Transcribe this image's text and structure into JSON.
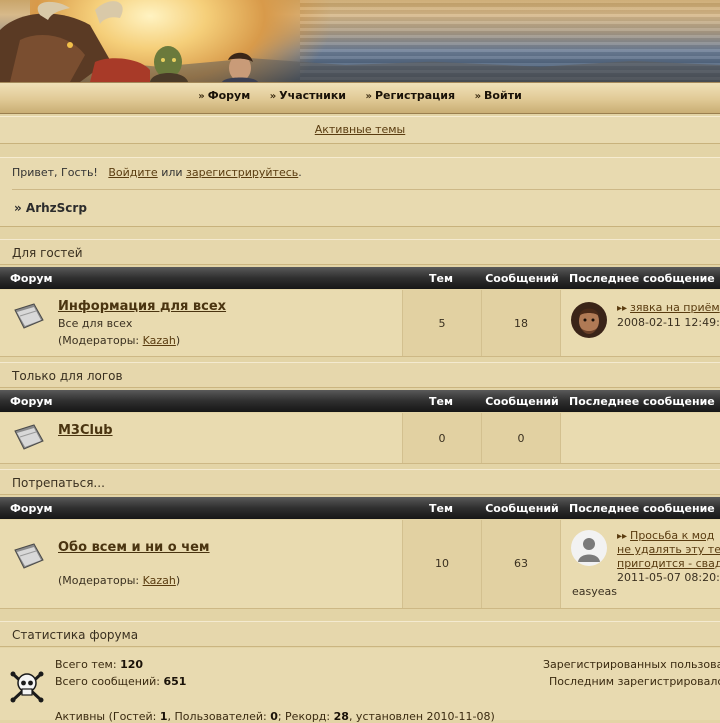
{
  "nav": {
    "items": [
      {
        "label": "Форум"
      },
      {
        "label": "Участники"
      },
      {
        "label": "Регистрация"
      },
      {
        "label": "Войти"
      }
    ]
  },
  "active_topics": "Активные темы",
  "welcome": {
    "greeting": "Привет, Гость!",
    "login_link": "Войдите",
    "or": "или",
    "register_link": "зарегистрируйтесь",
    "period": "."
  },
  "breadcrumb": "» ArhzScrp",
  "table_headers": {
    "forum": "Форум",
    "topics": "Тем",
    "posts": "Сообщений",
    "last_post": "Последнее сообщение"
  },
  "categories": [
    {
      "title": "Для гостей",
      "forums": [
        {
          "name": "Информация для всех",
          "description": "Все для всех",
          "moderators_prefix": "(Модераторы:",
          "moderator": "Kazah",
          "moderators_suffix": ")",
          "topics": "5",
          "posts": "18",
          "last_post_title": "зявка на приём",
          "last_post_date": "2008-02-11 12:49:"
        }
      ]
    },
    {
      "title": "Только для логов",
      "forums": [
        {
          "name": "M3Club",
          "topics": "0",
          "posts": "0"
        }
      ]
    },
    {
      "title": "Потрепаться...",
      "forums": [
        {
          "name": "Обо всем и ни о чем",
          "moderators_prefix": "(Модераторы:",
          "moderator": "Kazah",
          "moderators_suffix": ")",
          "topics": "10",
          "posts": "63",
          "last_post_lines": [
            "Просьба к мод",
            "не удалять эту те",
            "пригодится - свад"
          ],
          "last_post_date": "2011-05-07 08:20:",
          "last_post_author": "easyeas"
        }
      ]
    }
  ],
  "stats": {
    "title": "Статистика форума",
    "total_topics_label": "Всего тем:",
    "total_topics": "120",
    "total_posts_label": "Всего сообщений:",
    "total_posts": "651",
    "registered_label": "Зарегистрированных пользова",
    "last_registered_label": "Последним зарегистрировалс",
    "online_prefix": "Активны (Гостей:",
    "online_guests": "1",
    "online_users_label": ", Пользователей:",
    "online_users": "0",
    "online_record_label": "; Рекорд:",
    "online_record": "28",
    "online_record_date": ", установлен 2010-11-08)"
  },
  "colors": {
    "background": "#e3d4a6",
    "header_dark": "#1e1e1e",
    "link": "#5a3c10"
  }
}
